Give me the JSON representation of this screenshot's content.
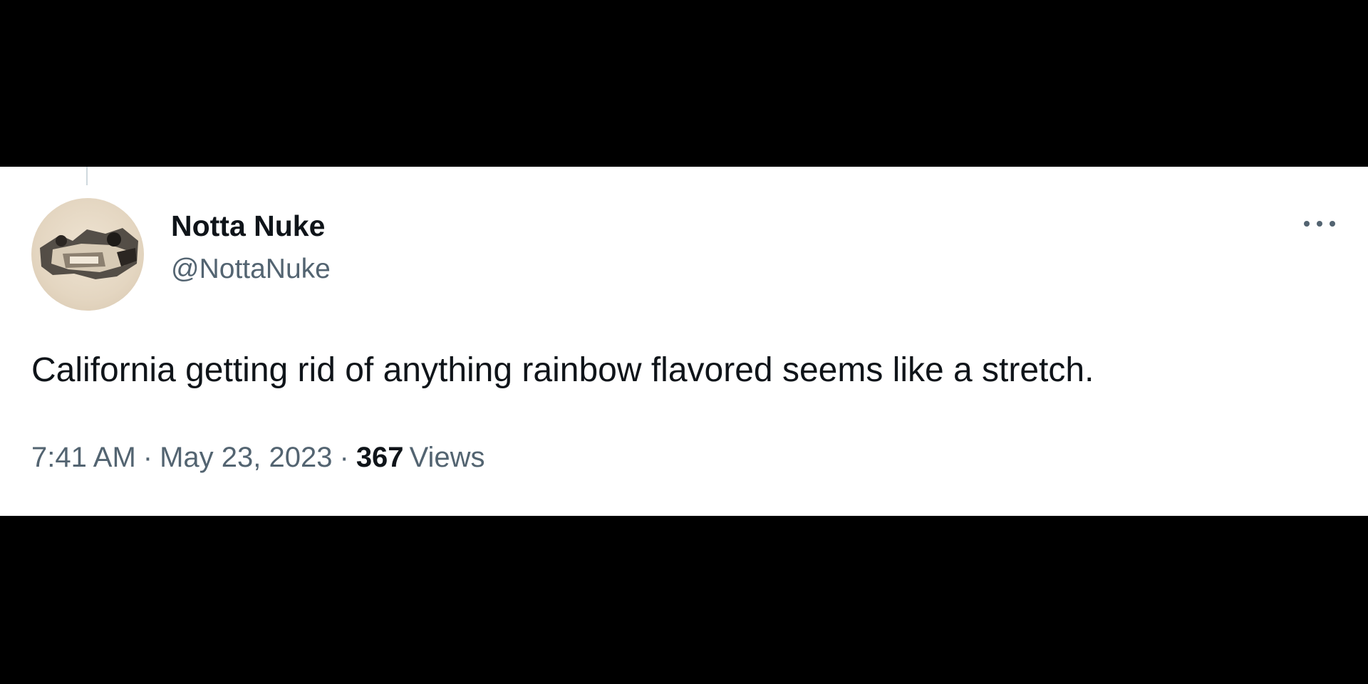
{
  "tweet": {
    "author": {
      "display_name": "Notta Nuke",
      "handle": "@NottaNuke"
    },
    "text": "California getting rid of anything rainbow flavored seems like a stretch.",
    "time": "7:41 AM",
    "date": "May 23, 2023",
    "separator": "·",
    "views_count": "367",
    "views_label": "Views",
    "more_icon": "more-dots-icon"
  },
  "colors": {
    "background": "#000000",
    "card": "#ffffff",
    "primary_text": "#0f1419",
    "secondary_text": "#536471",
    "thread_line": "#cfd9de"
  }
}
